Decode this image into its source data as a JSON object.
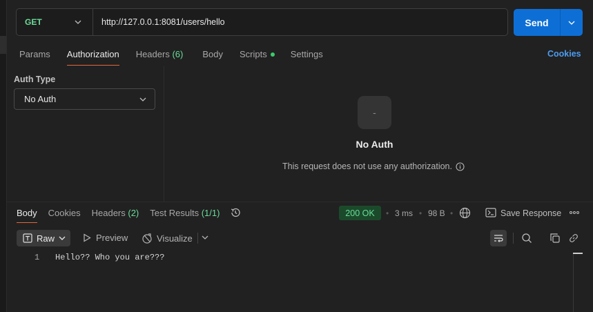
{
  "request": {
    "method": "GET",
    "url": "http://127.0.0.1:8081/users/hello",
    "send_label": "Send"
  },
  "request_tabs": [
    {
      "label": "Params"
    },
    {
      "label": "Authorization"
    },
    {
      "label": "Headers",
      "count": "(6)"
    },
    {
      "label": "Body"
    },
    {
      "label": "Scripts"
    },
    {
      "label": "Settings"
    }
  ],
  "cookies_link": "Cookies",
  "auth": {
    "type_label": "Auth Type",
    "selected": "No Auth",
    "empty_icon_text": "-",
    "empty_title": "No Auth",
    "empty_description": "This request does not use any authorization."
  },
  "response_tabs": [
    {
      "label": "Body"
    },
    {
      "label": "Cookies"
    },
    {
      "label": "Headers",
      "count": "(2)"
    },
    {
      "label": "Test Results",
      "count": "(1/1)"
    }
  ],
  "response_meta": {
    "status": "200 OK",
    "time": "3 ms",
    "size": "98 B",
    "save_label": "Save Response",
    "separator": "•"
  },
  "response_toolbar": {
    "format": "Raw",
    "preview": "Preview",
    "visualize": "Visualize"
  },
  "response_body": {
    "lines": [
      {
        "no": "1",
        "text": "Hello?? Who you are???"
      }
    ]
  },
  "colors": {
    "accent": "#0d6fd6",
    "tab_underline": "#e2683c",
    "method_get": "#6bdd9a",
    "status_ok_bg": "#1b4a2b",
    "link": "#4d9cf0"
  }
}
